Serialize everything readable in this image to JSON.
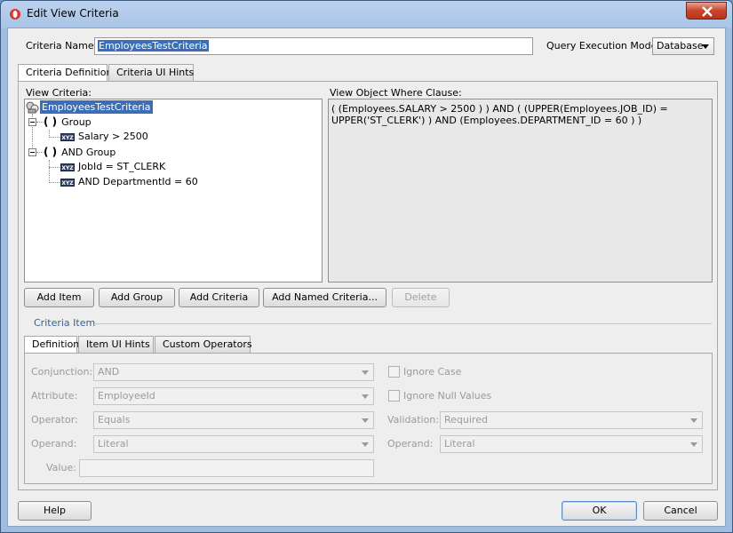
{
  "window": {
    "title": "Edit View Criteria"
  },
  "criteria_name": {
    "label": "Criteria Name:",
    "value": "EmployeesTestCriteria"
  },
  "query_mode": {
    "label": "Query Execution Mode:",
    "value": "Database"
  },
  "top_tabs": [
    "Criteria Definition",
    "Criteria UI Hints"
  ],
  "view_criteria": {
    "label": "View Criteria:",
    "tree": [
      {
        "text": "EmployeesTestCriteria"
      },
      {
        "text": "Group"
      },
      {
        "text": "Salary > 2500"
      },
      {
        "text": "AND Group"
      },
      {
        "text": "JobId = ST_CLERK"
      },
      {
        "text": "AND DepartmentId = 60"
      }
    ]
  },
  "where_clause": {
    "label": "View Object Where Clause:",
    "line1": "( (Employees.SALARY > 2500 ) )  AND ( (UPPER(Employees.JOB_ID) =",
    "line2": "UPPER('ST_CLERK') ) AND (Employees.DEPARTMENT_ID = 60 ) )"
  },
  "action_buttons": {
    "add_item": "Add Item",
    "add_group": "Add Group",
    "add_criteria": "Add Criteria",
    "add_named": "Add Named Criteria...",
    "delete": "Delete"
  },
  "criteria_item": {
    "heading": "Criteria Item",
    "tabs": [
      "Definition",
      "Item UI Hints",
      "Custom Operators"
    ],
    "conjunction": {
      "label": "Conjunction:",
      "value": "AND"
    },
    "attribute": {
      "label": "Attribute:",
      "value": "EmployeeId"
    },
    "operator": {
      "label": "Operator:",
      "value": "Equals"
    },
    "operand": {
      "label": "Operand:",
      "value": "Literal"
    },
    "value": {
      "label": "Value:",
      "value": ""
    },
    "ignore_case": "Ignore Case",
    "ignore_nulls": "Ignore Null Values",
    "validation": {
      "label": "Validation:",
      "value": "Required"
    },
    "operand2": {
      "label": "Operand:",
      "value": "Literal"
    }
  },
  "footer": {
    "help": "Help",
    "ok": "OK",
    "cancel": "Cancel"
  },
  "icons": {
    "app": "oracle-logo-icon",
    "close": "close-icon",
    "criteria": "view-criteria-icon",
    "item": "xyz-attribute-icon"
  },
  "colors": {
    "selection": "#3a6fb7",
    "titlebar": "#b3cce9"
  }
}
